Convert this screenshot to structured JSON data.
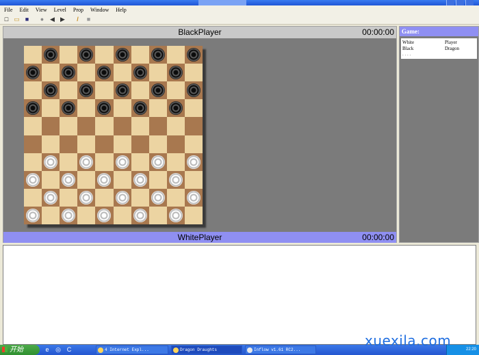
{
  "window": {
    "title": ""
  },
  "menu": [
    "File",
    "Edit",
    "View",
    "Level",
    "Prop",
    "Window",
    "Help"
  ],
  "toolbar": [
    {
      "icon": "new-file-icon",
      "glyph": "□"
    },
    {
      "icon": "open-folder-icon",
      "glyph": "▭"
    },
    {
      "icon": "save-icon",
      "glyph": "■"
    },
    {
      "icon": "stop-icon",
      "glyph": "●"
    },
    {
      "icon": "back-arrow-icon",
      "glyph": "◀"
    },
    {
      "icon": "forward-arrow-icon",
      "glyph": "▶"
    },
    {
      "icon": "pencil-icon",
      "glyph": "/"
    },
    {
      "icon": "grey-square-icon",
      "glyph": "■"
    }
  ],
  "game": {
    "top_player": "BlackPlayer",
    "top_time": "00:00:00",
    "bottom_player": "WhitePlayer",
    "bottom_time": "00:00:00"
  },
  "board": {
    "size": 10,
    "black_rows": [
      0,
      1,
      2,
      3
    ],
    "white_rows": [
      6,
      7,
      8,
      9
    ],
    "colors": {
      "light": "#ecd4a2",
      "dark": "#a8784f"
    }
  },
  "sidebar": {
    "header": "Game:",
    "rows": [
      {
        "label": "White",
        "value": "Player"
      },
      {
        "label": "Black",
        "value": "Dragon"
      }
    ],
    "more": ". . . ."
  },
  "taskbar": {
    "start_label": "开始",
    "quick_launch": [
      "e",
      "◎",
      "C"
    ],
    "tasks": [
      {
        "label": "4 Internet Expl...",
        "active": false
      },
      {
        "label": "Dragon Draughts",
        "active": true
      },
      {
        "label": "Inflow v1.61 RC2...",
        "active": false
      }
    ],
    "clock": "22:20"
  },
  "watermark": "xuexila.com"
}
